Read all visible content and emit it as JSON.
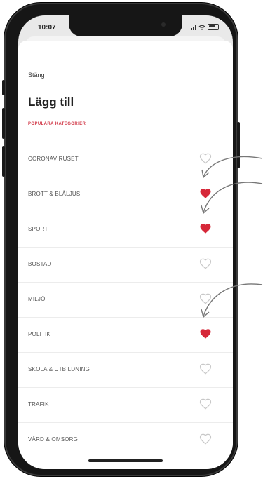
{
  "status_bar": {
    "time": "10:07"
  },
  "sheet": {
    "close_label": "Stäng",
    "title": "Lägg till",
    "section_label": "POPULÄRA KATEGORIER"
  },
  "categories": [
    {
      "label": "CORONAVIRUSET",
      "favorite": false
    },
    {
      "label": "BROTT & BLÅLJUS",
      "favorite": true
    },
    {
      "label": "SPORT",
      "favorite": true
    },
    {
      "label": "BOSTAD",
      "favorite": false
    },
    {
      "label": "MILJÖ",
      "favorite": false
    },
    {
      "label": "POLITIK",
      "favorite": true
    },
    {
      "label": "SKOLA & UTBILDNING",
      "favorite": false
    },
    {
      "label": "TRAFIK",
      "favorite": false
    },
    {
      "label": "VÅRD & OMSORG",
      "favorite": false
    }
  ],
  "colors": {
    "accent": "#d23b4a",
    "heart_filled": "#d62839",
    "heart_outline": "#c8c8c8"
  }
}
